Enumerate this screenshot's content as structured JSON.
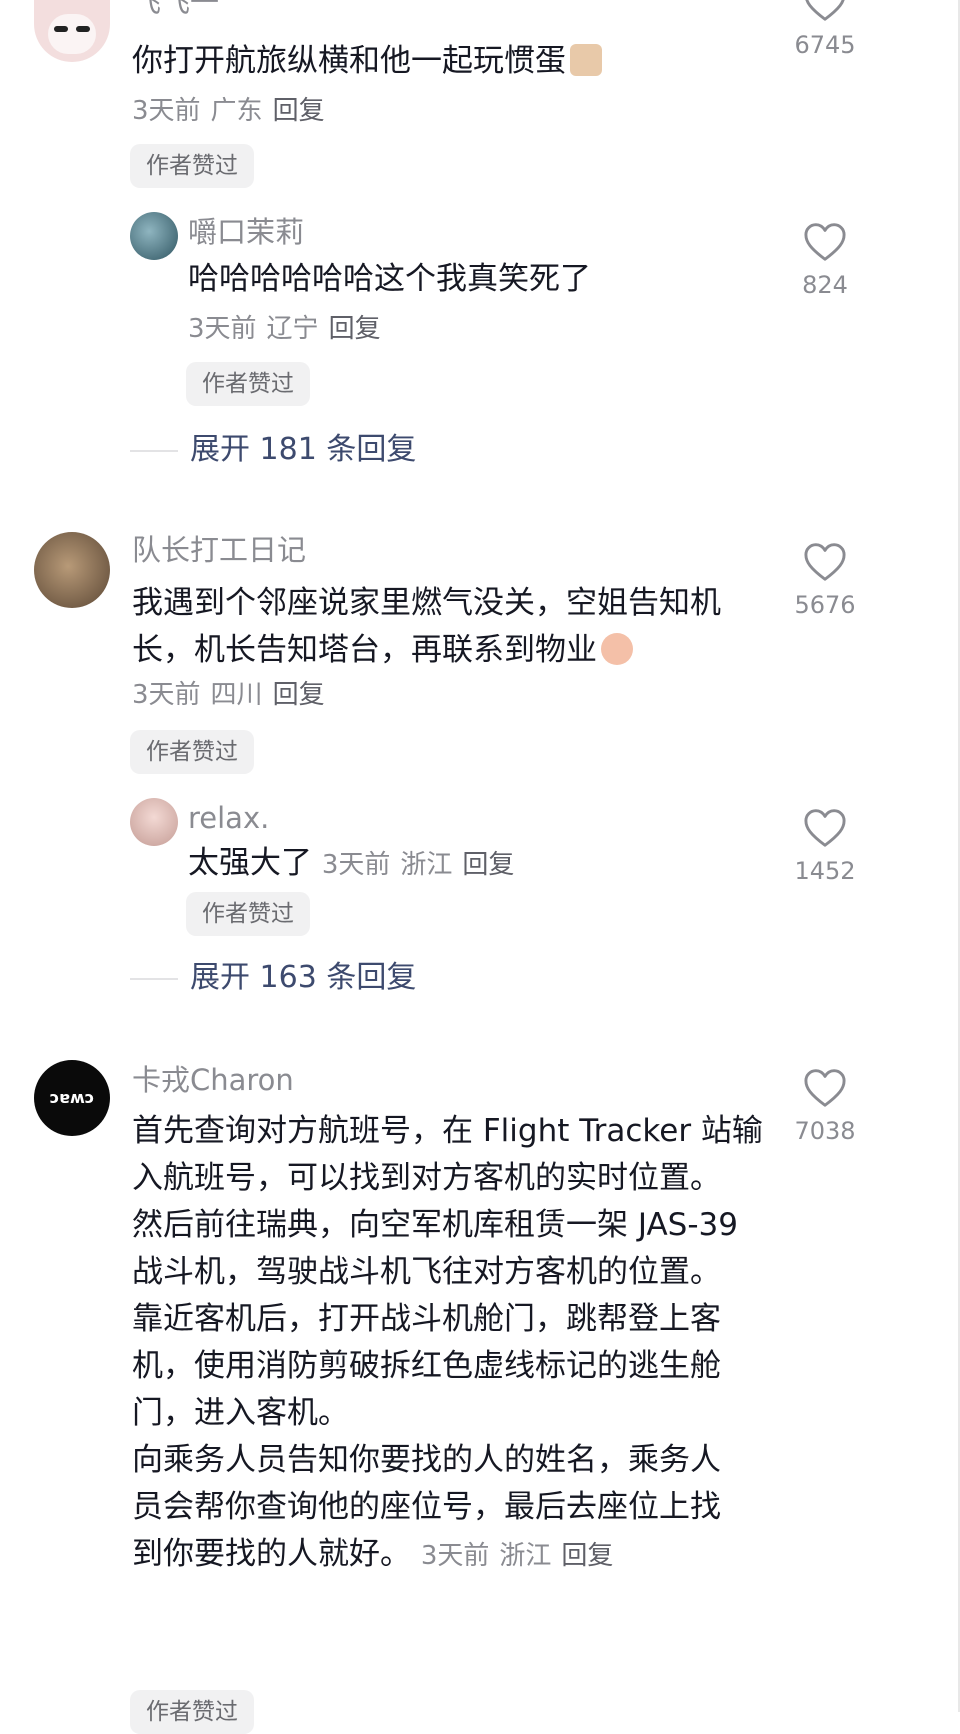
{
  "comments": [
    {
      "name": "飞飞一",
      "text": "你打开航旅纵横和他一起玩惯蛋",
      "time": "3天前",
      "location": "广东",
      "reply_label": "回复",
      "badge": "作者赞过",
      "likes": "6745",
      "replies": [
        {
          "name": "嚼口茉莉",
          "text": "哈哈哈哈哈哈这个我真笑死了",
          "time": "3天前",
          "location": "辽宁",
          "reply_label": "回复",
          "badge": "作者赞过",
          "likes": "824"
        }
      ],
      "expand": "展开 181 条回复"
    },
    {
      "name": "队长打工日记",
      "text": "我遇到个邻座说家里燃气没关，空姐告知机长，机长告知塔台，再联系到物业",
      "time": "3天前",
      "location": "四川",
      "reply_label": "回复",
      "badge": "作者赞过",
      "likes": "5676",
      "replies": [
        {
          "name": "relax.",
          "text": "太强大了",
          "time": "3天前",
          "location": "浙江",
          "reply_label": "回复",
          "badge": "作者赞过",
          "likes": "1452"
        }
      ],
      "expand": "展开 163 条回复"
    },
    {
      "name": "卡戎Charon",
      "avatar_text": "ɔɐʍɔ",
      "lines": [
        "首先查询对方航班号，在 Flight Tracker 站输",
        "入航班号，可以找到对方客机的实时位置。",
        "然后前往瑞典，向空军机库租赁一架 JAS-39",
        "战斗机，驾驶战斗机飞往对方客机的位置。",
        "靠近客机后，打开战斗机舱门，跳帮登上客",
        "机，使用消防剪破拆红色虚线标记的逃生舱",
        "门，进入客机。",
        "向乘务人员告知你要找的人的姓名，乘务人",
        "员会帮你查询他的座位号，最后去座位上找",
        "到你要找的人就好。"
      ],
      "time": "3天前",
      "location": "浙江",
      "reply_label": "回复",
      "badge": "作者赞过",
      "likes": "7038"
    }
  ],
  "colors": {
    "meta": "#8a8b91",
    "badge_bg": "#f1f1f2",
    "expand_text": "#3d4a6e"
  },
  "icons": {
    "like": "heart-outline-icon"
  }
}
